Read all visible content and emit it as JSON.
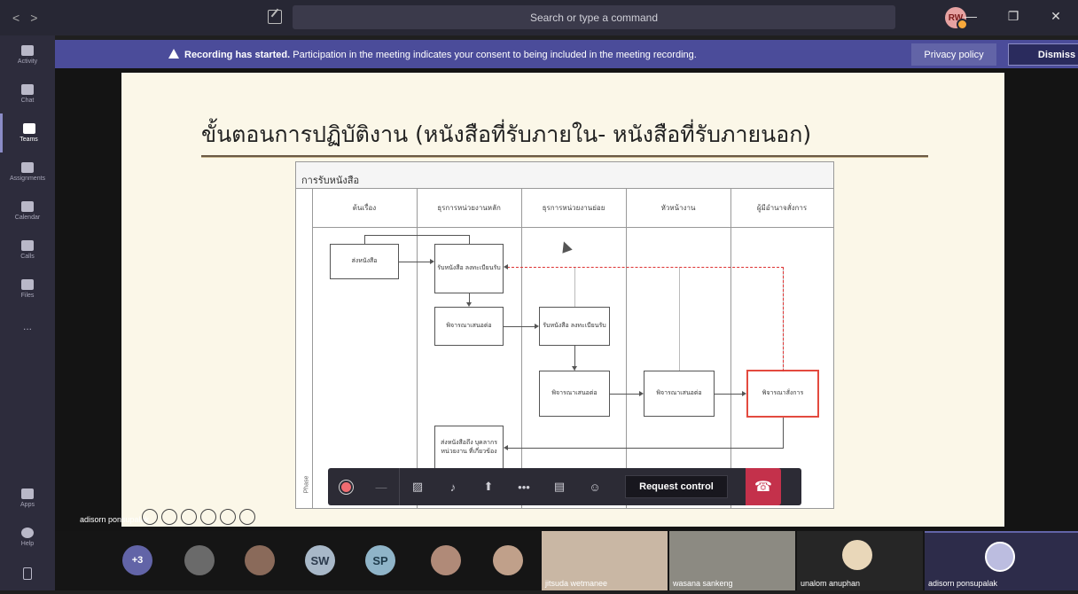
{
  "titlebar": {
    "back": "<",
    "forward": ">",
    "search_placeholder": "Search or type a command",
    "user_initials": "RW",
    "minimize": "—",
    "restore": "❐",
    "close": "✕"
  },
  "rail": {
    "items": [
      {
        "label": "Activity",
        "icon": "bell-icon"
      },
      {
        "label": "Chat",
        "icon": "chat-icon"
      },
      {
        "label": "Teams",
        "icon": "teams-icon"
      },
      {
        "label": "Assignments",
        "icon": "assignments-icon"
      },
      {
        "label": "Calendar",
        "icon": "calendar-icon"
      },
      {
        "label": "Calls",
        "icon": "phone-icon"
      },
      {
        "label": "Files",
        "icon": "files-icon"
      },
      {
        "label": "...",
        "icon": "more-icon"
      }
    ],
    "bottom": [
      {
        "label": "Apps",
        "icon": "apps-icon"
      },
      {
        "label": "Help",
        "icon": "help-icon"
      }
    ]
  },
  "banner": {
    "bold": "Recording has started.",
    "text": " Participation in the meeting indicates your consent to being included in the meeting recording.",
    "privacy": "Privacy policy",
    "dismiss": "Dismiss"
  },
  "slide": {
    "title": "ขั้นตอนการปฏิบัติงาน (หนังสือที่รับภายใน- หนังสือที่รับภายนอก)",
    "flow_header": "การรับหนังสือ",
    "lanes": [
      "ต้นเรื่อง",
      "ธุรการหน่วยงานหลัก",
      "ธุรการหน่วยงานย่อย",
      "หัวหน้างาน",
      "ผู้มีอำนาจสั่งการ"
    ],
    "boxes": {
      "send": "ส่งหนังสือ",
      "receive_main": "รับหนังสือ ลงทะเบียนรับ",
      "consider_main": "พิจารณาเสนอต่อ",
      "receive_sub": "รับหนังสือ ลงทะเบียนรับ",
      "consider_sub": "พิจารณาเสนอต่อ",
      "consider_head": "พิจารณาเสนอต่อ",
      "order": "พิจารณาสั่งการ",
      "forward": "ส่งหนังสือถึง บุคลากรหน่วยงาน ที่เกี่ยวข้อง"
    },
    "phase": "Phase"
  },
  "controls": {
    "more": "•••",
    "request_control": "Request control"
  },
  "presenter": "adisorn ponsupalak",
  "participants": {
    "overflow": "+3",
    "avatars": [
      {
        "initials": "",
        "color": "#6a6a6a"
      },
      {
        "initials": "",
        "color": "#8a6a5a"
      },
      {
        "initials": "SW",
        "color": "#a8b8c8"
      },
      {
        "initials": "SP",
        "color": "#8fb4c8"
      },
      {
        "initials": "",
        "color": "#b08a78"
      },
      {
        "initials": "",
        "color": "#c0a08a"
      }
    ],
    "tiles": [
      {
        "name": "jitsuda wetmanee"
      },
      {
        "name": "wasana sankeng"
      },
      {
        "name": "unalom anuphan"
      },
      {
        "name": "adisorn ponsupalak"
      }
    ]
  }
}
